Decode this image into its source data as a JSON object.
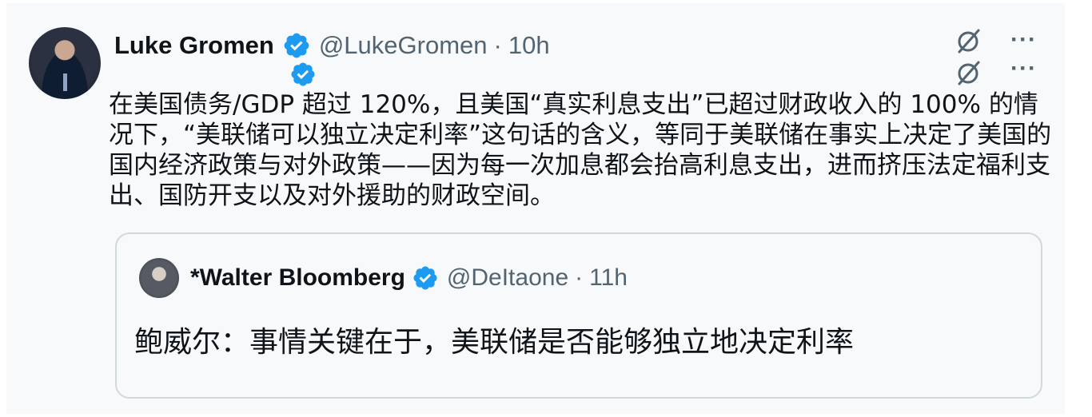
{
  "tweet": {
    "author_name": "Luke Gromen",
    "handle": "@LukeGromen",
    "separator": "·",
    "time": "10h",
    "body": "在美国债务/GDP 超过 120%，且美国“真实利息支出”已超过财政收入的 100% 的情况下，“美联储可以独立决定利率”这句话的含义，等同于美联储在事实上决定了美国的国内经济政策与对外政策——因为每一次加息都会抬高利息支出，进而挤压法定福利支出、国防开支以及对外援助的财政空间。",
    "more_glyph": "···"
  },
  "quoted_tweet": {
    "author_name": "*Walter Bloomberg",
    "handle": "@DeItaone",
    "separator": "·",
    "time": "11h",
    "body": "鲍威尔：事情关键在于，美联储是否能够独立地决定利率"
  },
  "colors": {
    "text_primary": "#0f1419",
    "text_secondary": "#536471",
    "verified_blue": "#1d9bf0",
    "border": "#cfd9de",
    "background": "#f7f9fa"
  },
  "icons": {
    "verified": "verified-badge-icon",
    "grok": "slashed-circle-icon",
    "more": "more-options-icon"
  }
}
